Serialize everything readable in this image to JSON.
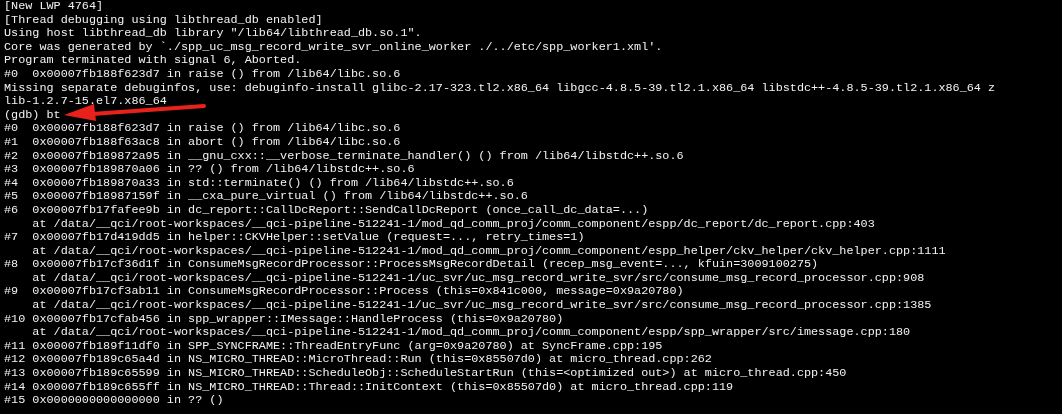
{
  "terminal": {
    "lines": [
      "[New LWP 4764]",
      "[Thread debugging using libthread_db enabled]",
      "Using host libthread_db library \"/lib64/libthread_db.so.1\".",
      "Core was generated by `./spp_uc_msg_record_write_svr_online_worker ./../etc/spp_worker1.xml'.",
      "Program terminated with signal 6, Aborted.",
      "#0  0x00007fb188f623d7 in raise () from /lib64/libc.so.6",
      "Missing separate debuginfos, use: debuginfo-install glibc-2.17-323.tl2.x86_64 libgcc-4.8.5-39.tl2.1.x86_64 libstdc++-4.8.5-39.tl2.1.x86_64 z",
      "lib-1.2.7-15.el7.x86_64",
      "(gdb) bt",
      "#0  0x00007fb188f623d7 in raise () from /lib64/libc.so.6",
      "#1  0x00007fb188f63ac8 in abort () from /lib64/libc.so.6",
      "#2  0x00007fb189872a95 in __gnu_cxx::__verbose_terminate_handler() () from /lib64/libstdc++.so.6",
      "#3  0x00007fb189870a06 in ?? () from /lib64/libstdc++.so.6",
      "#4  0x00007fb189870a33 in std::terminate() () from /lib64/libstdc++.so.6",
      "#5  0x00007fb18987159f in __cxa_pure_virtual () from /lib64/libstdc++.so.6",
      "#6  0x00007fb17fafee9b in dc_report::CallDcReport::SendCallDcReport (once_call_dc_data=...)",
      "    at /data/__qci/root-workspaces/__qci-pipeline-512241-1/mod_qd_comm_proj/comm_component/espp/dc_report/dc_report.cpp:403",
      "#7  0x00007fb17d419dd5 in helper::CKVHelper::setValue (request=..., retry_times=1)",
      "    at /data/__qci/root-workspaces/__qci-pipeline-512241-1/mod_qd_comm_proj/comm_component/espp_helper/ckv_helper/ckv_helper.cpp:1111",
      "#8  0x00007fb17cf36d1f in ConsumeMsgRecordProcessor::ProcessMsgRecordDetail (recep_msg_event=..., kfuin=3009100275)",
      "    at /data/__qci/root-workspaces/__qci-pipeline-512241-1/uc_svr/uc_msg_record_write_svr/src/consume_msg_record_processor.cpp:908",
      "#9  0x00007fb17cf3ab11 in ConsumeMsgRecordProcessor::Process (this=0x841c000, message=0x9a20780)",
      "    at /data/__qci/root-workspaces/__qci-pipeline-512241-1/uc_svr/uc_msg_record_write_svr/src/consume_msg_record_processor.cpp:1385",
      "#10 0x00007fb17cfab456 in spp_wrapper::IMessage::HandleProcess (this=0x9a20780)",
      "    at /data/__qci/root-workspaces/__qci-pipeline-512241-1/mod_qd_comm_proj/comm_component/espp/spp_wrapper/src/imessage.cpp:180",
      "#11 0x00007fb189f11df0 in SPP_SYNCFRAME::ThreadEntryFunc (arg=0x9a20780) at SyncFrame.cpp:195",
      "#12 0x00007fb189c65a4d in NS_MICRO_THREAD::MicroThread::Run (this=0x85507d0) at micro_thread.cpp:262",
      "#13 0x00007fb189c65599 in NS_MICRO_THREAD::ScheduleObj::ScheduleStartRun (this=<optimized out>) at micro_thread.cpp:450",
      "#14 0x00007fb189c655ff in NS_MICRO_THREAD::Thread::InitContext (this=0x85507d0) at micro_thread.cpp:119",
      "#15 0x0000000000000000 in ?? ()"
    ]
  }
}
